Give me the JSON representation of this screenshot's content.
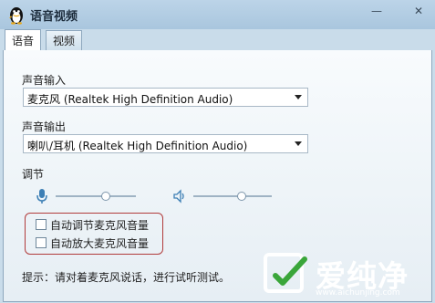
{
  "window": {
    "title": "语音视频",
    "minimize_glyph": "—",
    "close_glyph": "✕"
  },
  "tabs": [
    {
      "label": "语音",
      "active": true
    },
    {
      "label": "视频",
      "active": false
    }
  ],
  "input": {
    "label": "声音输入",
    "selected": "麦克风 (Realtek High Definition Audio)"
  },
  "output": {
    "label": "声音输出",
    "selected": "喇叭/耳机 (Realtek High Definition Audio)"
  },
  "adjust": {
    "label": "调节",
    "mic_level": 0.62,
    "speaker_level": 0.62
  },
  "options": {
    "auto_adjust_label": "自动调节麦克风音量",
    "auto_adjust_checked": false,
    "auto_amplify_label": "自动放大麦克风音量",
    "auto_amplify_checked": false
  },
  "hint": "提示：请对着麦克风说话，进行试听测试。",
  "watermark": {
    "text": "爱纯净",
    "url": "www.aichunjing.com"
  },
  "colors": {
    "highlight_border": "#b13b3b",
    "accent_icon": "#3d7fb5"
  }
}
